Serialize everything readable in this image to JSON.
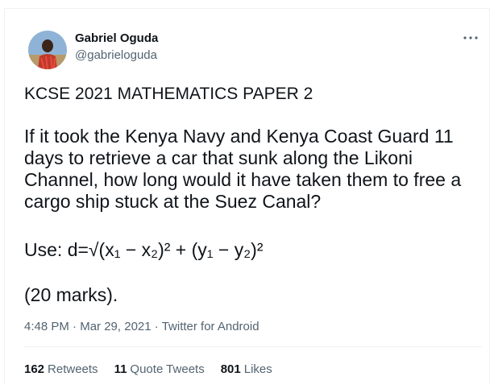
{
  "author": {
    "display_name": "Gabriel Oguda",
    "handle": "@gabrieloguda",
    "avatar_icon": "user-avatar-photo"
  },
  "more_icon": "more-dots-icon",
  "tweet": {
    "title": "KCSE 2021 MATHEMATICS PAPER 2",
    "question": "If it took the Kenya Navy and Kenya Coast Guard 11 days to retrieve a car that sunk  along the Likoni Channel, how long would it have taken them to free a cargo ship stuck at the Suez Canal?",
    "use_label": "Use: ",
    "formula": "d=√(x₁ − x₂)² + (y₁ − y₂)²",
    "marks": "(20 marks)."
  },
  "meta": {
    "time": "4:48 PM",
    "separator": "·",
    "date": "Mar 29, 2021",
    "source": "Twitter for Android"
  },
  "stats": {
    "retweets_count": "162",
    "retweets_label": "Retweets",
    "quote_count": "11",
    "quote_label": "Quote Tweets",
    "likes_count": "801",
    "likes_label": "Likes"
  },
  "colors": {
    "text": "#0f1419",
    "secondary": "#536471",
    "divider": "#eff3f4"
  }
}
